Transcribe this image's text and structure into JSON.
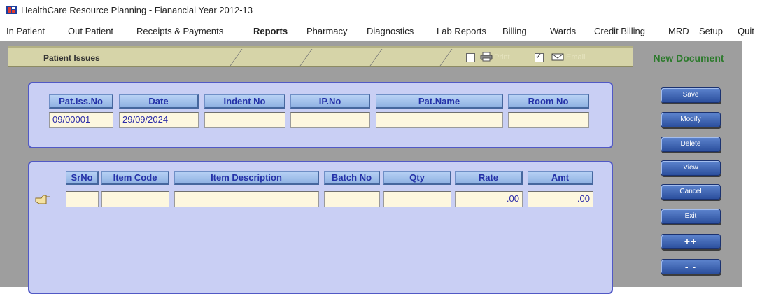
{
  "window": {
    "title": "HealthCare Resource Planning - Fianancial Year 2012-13"
  },
  "menu": [
    {
      "label": "In Patient"
    },
    {
      "label": "Out Patient"
    },
    {
      "label": "Receipts & Payments"
    },
    {
      "label": "Reports",
      "active": true
    },
    {
      "label": "Pharmacy"
    },
    {
      "label": "Diagnostics"
    },
    {
      "label": "Lab Reports"
    },
    {
      "label": "Billing"
    },
    {
      "label": "Wards"
    },
    {
      "label": "Credit Billing"
    },
    {
      "label": "MRD"
    },
    {
      "label": "Setup"
    },
    {
      "label": "Quit"
    }
  ],
  "form": {
    "title": "Patient Issues",
    "print_checked": false,
    "email_checked": true,
    "status": "New Document"
  },
  "header_table": {
    "columns": [
      "Pat.Iss.No",
      "Date",
      "Indent No",
      "IP.No",
      "Pat.Name",
      "Room No"
    ],
    "values": [
      "09/00001",
      "29/09/2024",
      "",
      "",
      "",
      ""
    ]
  },
  "items_table": {
    "columns": [
      "SrNo",
      "Item Code",
      "Item Description",
      "Batch No",
      "Qty",
      "Rate",
      "Amt"
    ],
    "rows": [
      [
        "",
        "",
        "",
        "",
        "",
        ".00",
        ".00"
      ]
    ]
  },
  "buttons": {
    "save": "Save",
    "modify": "Modify",
    "delete": "Delete",
    "view": "View",
    "cancel": "Cancel",
    "exit": "Exit",
    "next": "++",
    "prev": "- -"
  },
  "colors": {
    "panel": "#c9cff4",
    "panel_border": "#5159c5",
    "header_text": "#2431a8",
    "field_bg": "#fdf7df",
    "status_text": "#2c7a2c",
    "button": "#2b4f9d"
  }
}
